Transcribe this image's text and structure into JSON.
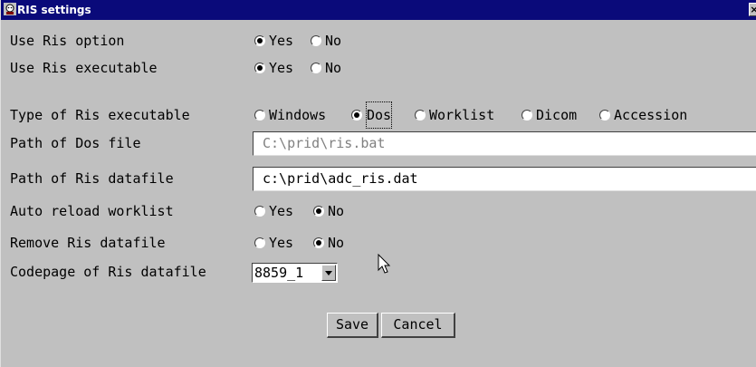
{
  "window": {
    "title": "RIS settings",
    "close_label": "×"
  },
  "rows": [
    {
      "label": "Use Ris option",
      "options": [
        "Yes",
        "No"
      ],
      "selected": "Yes"
    },
    {
      "label": "Use Ris executable",
      "options": [
        "Yes",
        "No"
      ],
      "selected": "Yes"
    },
    {
      "label": "Type of Ris executable",
      "options": [
        "Windows",
        "Dos",
        "Worklist",
        "Dicom",
        "Accession"
      ],
      "selected": "Dos"
    },
    {
      "label": "Path of Dos file",
      "value": "C:\\prid\\ris.bat",
      "disabled": true
    },
    {
      "label": "Path of Ris datafile",
      "value": "c:\\prid\\adc_ris.dat",
      "disabled": false
    },
    {
      "label": "Auto reload worklist",
      "options": [
        "Yes",
        "No"
      ],
      "selected": "No"
    },
    {
      "label": "Remove Ris datafile",
      "options": [
        "Yes",
        "No"
      ],
      "selected": "No"
    },
    {
      "label": "Codepage of Ris datafile",
      "select_value": "8859_1"
    }
  ],
  "buttons": {
    "save": "Save",
    "cancel": "Cancel"
  }
}
